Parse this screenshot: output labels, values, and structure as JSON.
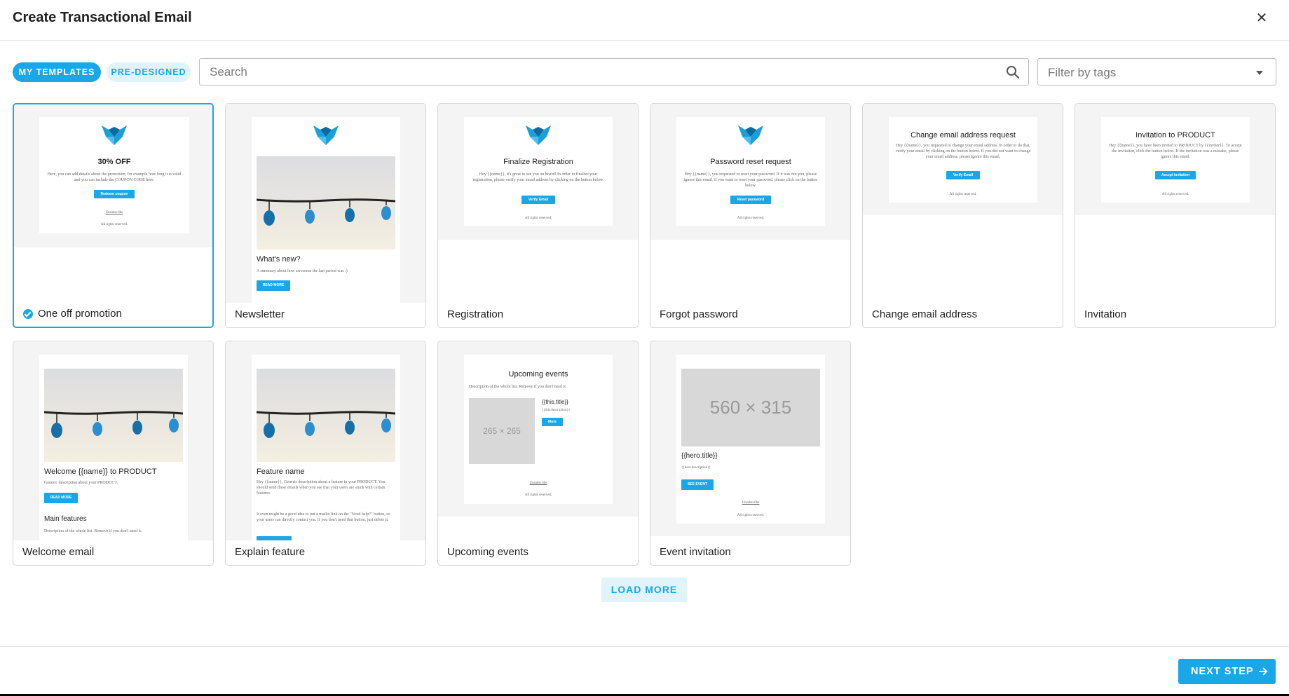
{
  "dialog": {
    "title": "Create Transactional Email"
  },
  "tabs": {
    "my_templates": "MY TEMPLATES",
    "pre_designed": "PRE-DESIGNED"
  },
  "search": {
    "placeholder": "Search"
  },
  "filter": {
    "placeholder": "Filter by tags"
  },
  "templates": [
    {
      "label": "One off promotion",
      "selected": true,
      "preview": {
        "heading": "30% OFF",
        "body": "Here, you can add details about the promotion, for example how long it is valid and you can include the COUPON CODE here.",
        "button": "Redeem coupon",
        "link": "Unsubscribe",
        "footer": "All rights reserved."
      }
    },
    {
      "label": "Newsletter",
      "preview": {
        "heading": "What's new?",
        "body": "A summary about how awesome the last period was :)",
        "button": "READ MORE"
      }
    },
    {
      "label": "Registration",
      "preview": {
        "heading": "Finalize Registration",
        "body": "Hey {{name}}, it's great to see you on board! In order to finalize your registration, please verify your email address by clicking on the button below.",
        "button": "Verify Email",
        "footer": "All rights reserved."
      }
    },
    {
      "label": "Forgot password",
      "preview": {
        "heading": "Password reset request",
        "body": "Hey {{name}}, you requested to reset your password. If it was not you, please ignore this email, if you want to reset your password, please click on the button below.",
        "button": "Reset password",
        "footer": "All rights reserved."
      }
    },
    {
      "label": "Change email address",
      "preview": {
        "heading": "Change email address request",
        "body": "Hey {{name}}, you requested to change your email address. In order to do that, verify your email by clicking on the button below. If you did not want to change your email address, please ignore this email.",
        "button": "Verify Email",
        "footer": "All rights reserved."
      }
    },
    {
      "label": "Invitation",
      "preview": {
        "heading": "Invitation to PRODUCT",
        "body": "Hey {{name}}, you have been invited to PRODUCT by {{inviter}}. To accept the invitation, click the button below. If the invitation was a mistake, please ignore this email.",
        "button": "Accept invitation",
        "footer": "All rights reserved."
      }
    },
    {
      "label": "Welcome email",
      "preview": {
        "heading": "Welcome {{name}} to PRODUCT",
        "body": "Generic description about your PRODUCT.",
        "button": "READ MORE",
        "subheading": "Main features",
        "body2": "Description of the whole list. Remove if you don't need it."
      }
    },
    {
      "label": "Explain feature",
      "preview": {
        "heading": "Feature name",
        "body": "Hey {{name}}, Generic description about a feature in your PRODUCT. You should send these emails when you see that your users are stuck with certain features.",
        "body2": "It even might be a good idea to put a mailto link on the \"Need help?\" button, so your users can directly contact you. If you don't need that button, just delete it."
      }
    },
    {
      "label": "Upcoming events",
      "preview": {
        "heading": "Upcoming events",
        "body": "Description of the whole list. Remove if you don't need it.",
        "image": "265 × 265",
        "item_title": "{{this.title}}",
        "item_desc": "{{this.description}}",
        "button": "More",
        "link": "Unsubscribe",
        "footer": "All rights reserved."
      }
    },
    {
      "label": "Event invitation",
      "preview": {
        "image": "560 × 315",
        "heading": "{{hero.title}}",
        "body": "{{hero.description}}",
        "button": "SEE EVENT",
        "link": "Unsubscribe",
        "footer": "All rights reserved."
      }
    }
  ],
  "load_more": "LOAD MORE",
  "next_step": "NEXT STEP",
  "colors": {
    "accent": "#1aa7e8",
    "accent_light": "#e1f3fc",
    "border": "#d6d6d6",
    "logo": "#1c9fd8"
  },
  "icons": {
    "close": "close-icon",
    "search": "search-icon",
    "dropdown": "chevron-down-icon",
    "check": "check-circle-icon",
    "arrow": "arrow-right-icon",
    "logo": "fox-logo-icon"
  }
}
